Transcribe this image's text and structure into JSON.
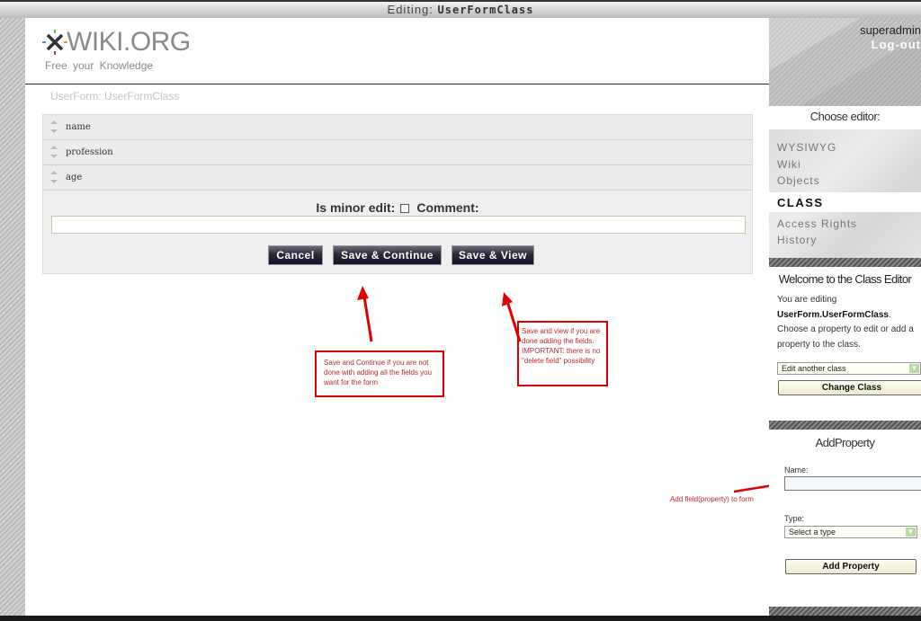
{
  "window": {
    "title_prefix": "Editing:",
    "title_doc": "UserFormClass"
  },
  "header": {
    "logo_text": "WIKI.ORG",
    "logo_tagline": "Free your Knowledge",
    "breadcrumb": "UserForm: UserFormClass"
  },
  "class_editor": {
    "properties": [
      {
        "name": "name"
      },
      {
        "name": "profession"
      },
      {
        "name": "age"
      }
    ],
    "minor_edit_label": "Is minor edit:",
    "minor_edit_checked": false,
    "comment_label": "Comment:",
    "comment_value": "",
    "buttons": {
      "cancel": "Cancel",
      "save_continue": "Save & Continue",
      "save_view": "Save & View"
    }
  },
  "annotations": {
    "save_continue_note": "Save and Continue if you are not done with adding all the fields you want for the form",
    "save_view_note": "Save and view if you are done adding the fields. IMPORTANT: there is no \"delete field\" possibility",
    "add_field_note": "Add field(property) to form",
    "color": "#e00000"
  },
  "sidebar": {
    "user": "superadmin",
    "logout": "Log-out",
    "choose_editor_title": "Choose editor:",
    "editors": [
      {
        "label": "WYSIWYG",
        "active": false
      },
      {
        "label": "Wiki",
        "active": false
      },
      {
        "label": "Objects",
        "active": false
      },
      {
        "label": "CLASS",
        "active": true
      },
      {
        "label": "Access Rights",
        "active": false
      },
      {
        "label": "History",
        "active": false
      }
    ],
    "welcome": {
      "title": "Welcome to the Class Editor",
      "line1": "You are editing",
      "class_name": "UserForm.UserFormClass",
      "line3": "Choose a property to edit or add a property to the class.",
      "select_value": "Edit another class",
      "change_button": "Change Class"
    },
    "add_property": {
      "title": "AddProperty",
      "name_label": "Name:",
      "name_value": "",
      "type_label": "Type:",
      "type_value": "Select a type",
      "button": "Add Property"
    }
  }
}
